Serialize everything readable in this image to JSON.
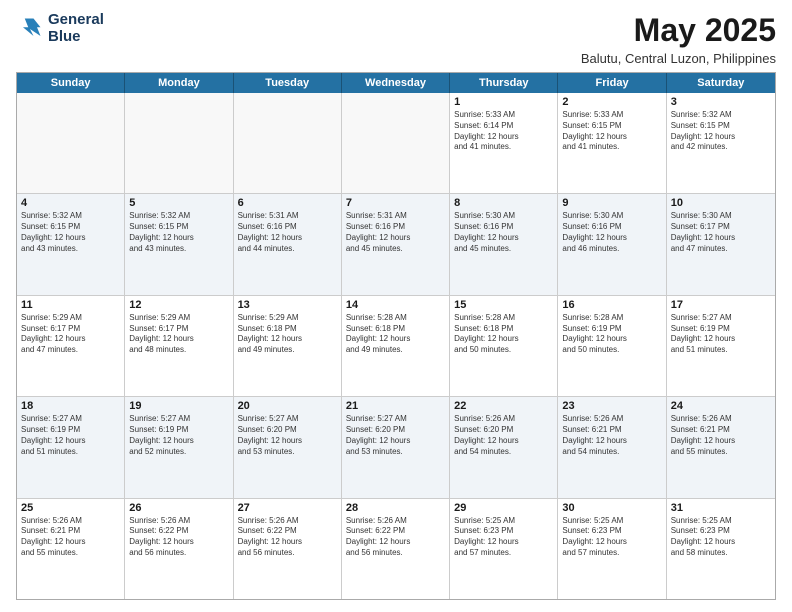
{
  "logo": {
    "line1": "General",
    "line2": "Blue"
  },
  "title": "May 2025",
  "location": "Balutu, Central Luzon, Philippines",
  "days_of_week": [
    "Sunday",
    "Monday",
    "Tuesday",
    "Wednesday",
    "Thursday",
    "Friday",
    "Saturday"
  ],
  "rows": [
    [
      {
        "day": "",
        "text": ""
      },
      {
        "day": "",
        "text": ""
      },
      {
        "day": "",
        "text": ""
      },
      {
        "day": "",
        "text": ""
      },
      {
        "day": "1",
        "text": "Sunrise: 5:33 AM\nSunset: 6:14 PM\nDaylight: 12 hours\nand 41 minutes."
      },
      {
        "day": "2",
        "text": "Sunrise: 5:33 AM\nSunset: 6:15 PM\nDaylight: 12 hours\nand 41 minutes."
      },
      {
        "day": "3",
        "text": "Sunrise: 5:32 AM\nSunset: 6:15 PM\nDaylight: 12 hours\nand 42 minutes."
      }
    ],
    [
      {
        "day": "4",
        "text": "Sunrise: 5:32 AM\nSunset: 6:15 PM\nDaylight: 12 hours\nand 43 minutes."
      },
      {
        "day": "5",
        "text": "Sunrise: 5:32 AM\nSunset: 6:15 PM\nDaylight: 12 hours\nand 43 minutes."
      },
      {
        "day": "6",
        "text": "Sunrise: 5:31 AM\nSunset: 6:16 PM\nDaylight: 12 hours\nand 44 minutes."
      },
      {
        "day": "7",
        "text": "Sunrise: 5:31 AM\nSunset: 6:16 PM\nDaylight: 12 hours\nand 45 minutes."
      },
      {
        "day": "8",
        "text": "Sunrise: 5:30 AM\nSunset: 6:16 PM\nDaylight: 12 hours\nand 45 minutes."
      },
      {
        "day": "9",
        "text": "Sunrise: 5:30 AM\nSunset: 6:16 PM\nDaylight: 12 hours\nand 46 minutes."
      },
      {
        "day": "10",
        "text": "Sunrise: 5:30 AM\nSunset: 6:17 PM\nDaylight: 12 hours\nand 47 minutes."
      }
    ],
    [
      {
        "day": "11",
        "text": "Sunrise: 5:29 AM\nSunset: 6:17 PM\nDaylight: 12 hours\nand 47 minutes."
      },
      {
        "day": "12",
        "text": "Sunrise: 5:29 AM\nSunset: 6:17 PM\nDaylight: 12 hours\nand 48 minutes."
      },
      {
        "day": "13",
        "text": "Sunrise: 5:29 AM\nSunset: 6:18 PM\nDaylight: 12 hours\nand 49 minutes."
      },
      {
        "day": "14",
        "text": "Sunrise: 5:28 AM\nSunset: 6:18 PM\nDaylight: 12 hours\nand 49 minutes."
      },
      {
        "day": "15",
        "text": "Sunrise: 5:28 AM\nSunset: 6:18 PM\nDaylight: 12 hours\nand 50 minutes."
      },
      {
        "day": "16",
        "text": "Sunrise: 5:28 AM\nSunset: 6:19 PM\nDaylight: 12 hours\nand 50 minutes."
      },
      {
        "day": "17",
        "text": "Sunrise: 5:27 AM\nSunset: 6:19 PM\nDaylight: 12 hours\nand 51 minutes."
      }
    ],
    [
      {
        "day": "18",
        "text": "Sunrise: 5:27 AM\nSunset: 6:19 PM\nDaylight: 12 hours\nand 51 minutes."
      },
      {
        "day": "19",
        "text": "Sunrise: 5:27 AM\nSunset: 6:19 PM\nDaylight: 12 hours\nand 52 minutes."
      },
      {
        "day": "20",
        "text": "Sunrise: 5:27 AM\nSunset: 6:20 PM\nDaylight: 12 hours\nand 53 minutes."
      },
      {
        "day": "21",
        "text": "Sunrise: 5:27 AM\nSunset: 6:20 PM\nDaylight: 12 hours\nand 53 minutes."
      },
      {
        "day": "22",
        "text": "Sunrise: 5:26 AM\nSunset: 6:20 PM\nDaylight: 12 hours\nand 54 minutes."
      },
      {
        "day": "23",
        "text": "Sunrise: 5:26 AM\nSunset: 6:21 PM\nDaylight: 12 hours\nand 54 minutes."
      },
      {
        "day": "24",
        "text": "Sunrise: 5:26 AM\nSunset: 6:21 PM\nDaylight: 12 hours\nand 55 minutes."
      }
    ],
    [
      {
        "day": "25",
        "text": "Sunrise: 5:26 AM\nSunset: 6:21 PM\nDaylight: 12 hours\nand 55 minutes."
      },
      {
        "day": "26",
        "text": "Sunrise: 5:26 AM\nSunset: 6:22 PM\nDaylight: 12 hours\nand 56 minutes."
      },
      {
        "day": "27",
        "text": "Sunrise: 5:26 AM\nSunset: 6:22 PM\nDaylight: 12 hours\nand 56 minutes."
      },
      {
        "day": "28",
        "text": "Sunrise: 5:26 AM\nSunset: 6:22 PM\nDaylight: 12 hours\nand 56 minutes."
      },
      {
        "day": "29",
        "text": "Sunrise: 5:25 AM\nSunset: 6:23 PM\nDaylight: 12 hours\nand 57 minutes."
      },
      {
        "day": "30",
        "text": "Sunrise: 5:25 AM\nSunset: 6:23 PM\nDaylight: 12 hours\nand 57 minutes."
      },
      {
        "day": "31",
        "text": "Sunrise: 5:25 AM\nSunset: 6:23 PM\nDaylight: 12 hours\nand 58 minutes."
      }
    ]
  ]
}
